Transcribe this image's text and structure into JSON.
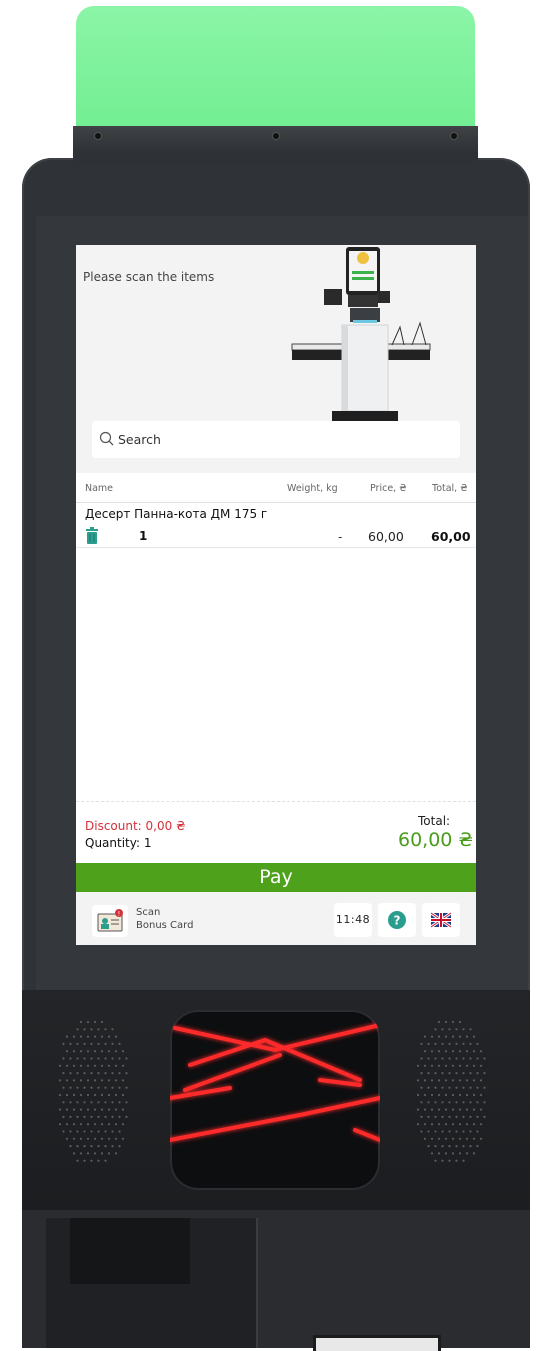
{
  "screen": {
    "prompt": "Please scan the items",
    "search": {
      "placeholder": "Search",
      "icon": "search-icon"
    },
    "table": {
      "headers": {
        "name": "Name",
        "weight": "Weight, kg",
        "price": "Price, ₴",
        "total": "Total, ₴"
      },
      "rows": [
        {
          "name": "Десерт Панна-кота ДМ 175 г",
          "quantity": "1",
          "weight": "-",
          "price": "60,00",
          "total": "60,00"
        }
      ]
    },
    "summary": {
      "discount": "Discount: 0,00 ₴",
      "quantity": "Quantity: 1",
      "total_label": "Total:",
      "total_value": "60,00 ₴"
    },
    "pay_label": "Pay",
    "bottom_bar": {
      "bonus_line1": "Scan",
      "bonus_line2": "Bonus Card",
      "clock": "11:48",
      "help_icon": "question-icon",
      "language_icon": "uk-flag-icon"
    }
  },
  "colors": {
    "pay": "#4da11b",
    "total": "#4a9d1c",
    "discount": "#d4313a",
    "status_light": "#7ff09a",
    "help": "#2a9d8f",
    "scanner_laser": "#ff2a2a"
  }
}
